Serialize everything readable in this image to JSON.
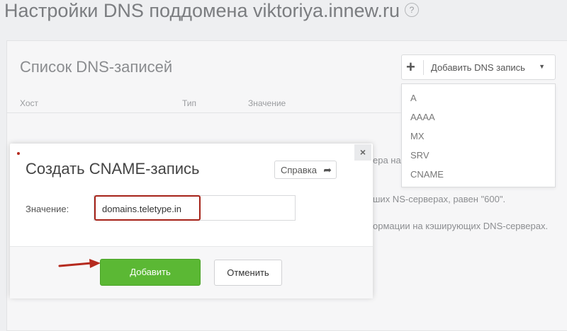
{
  "page": {
    "title": "Настройки DNS поддомена viktoriya.innew.ru",
    "help_symbol": "?"
  },
  "dns_list": {
    "title": "Список DNS-записей",
    "add_button": {
      "plus": "+",
      "label": "Добавить DNS запись",
      "caret": "▼"
    },
    "dropdown_options": [
      "A",
      "AAAA",
      "MX",
      "SRV",
      "CNAME"
    ],
    "columns": [
      "Хост",
      "Тип",
      "Значение"
    ],
    "background_fragments": [
      "ера на",
      "ших NS-серверах, равен \"600\".",
      "ормации на кэширующих DNS-серверах."
    ]
  },
  "modal": {
    "close_symbol": "×",
    "title": "Создать CNAME-запись",
    "help_label": "Справка",
    "help_arrow": "➦",
    "field_label": "Значение:",
    "field_value": "domains.teletype.in",
    "add_label": "Добавить",
    "cancel_label": "Отменить"
  },
  "colors": {
    "accent_green": "#5bb834",
    "highlight_red": "#a52218"
  }
}
